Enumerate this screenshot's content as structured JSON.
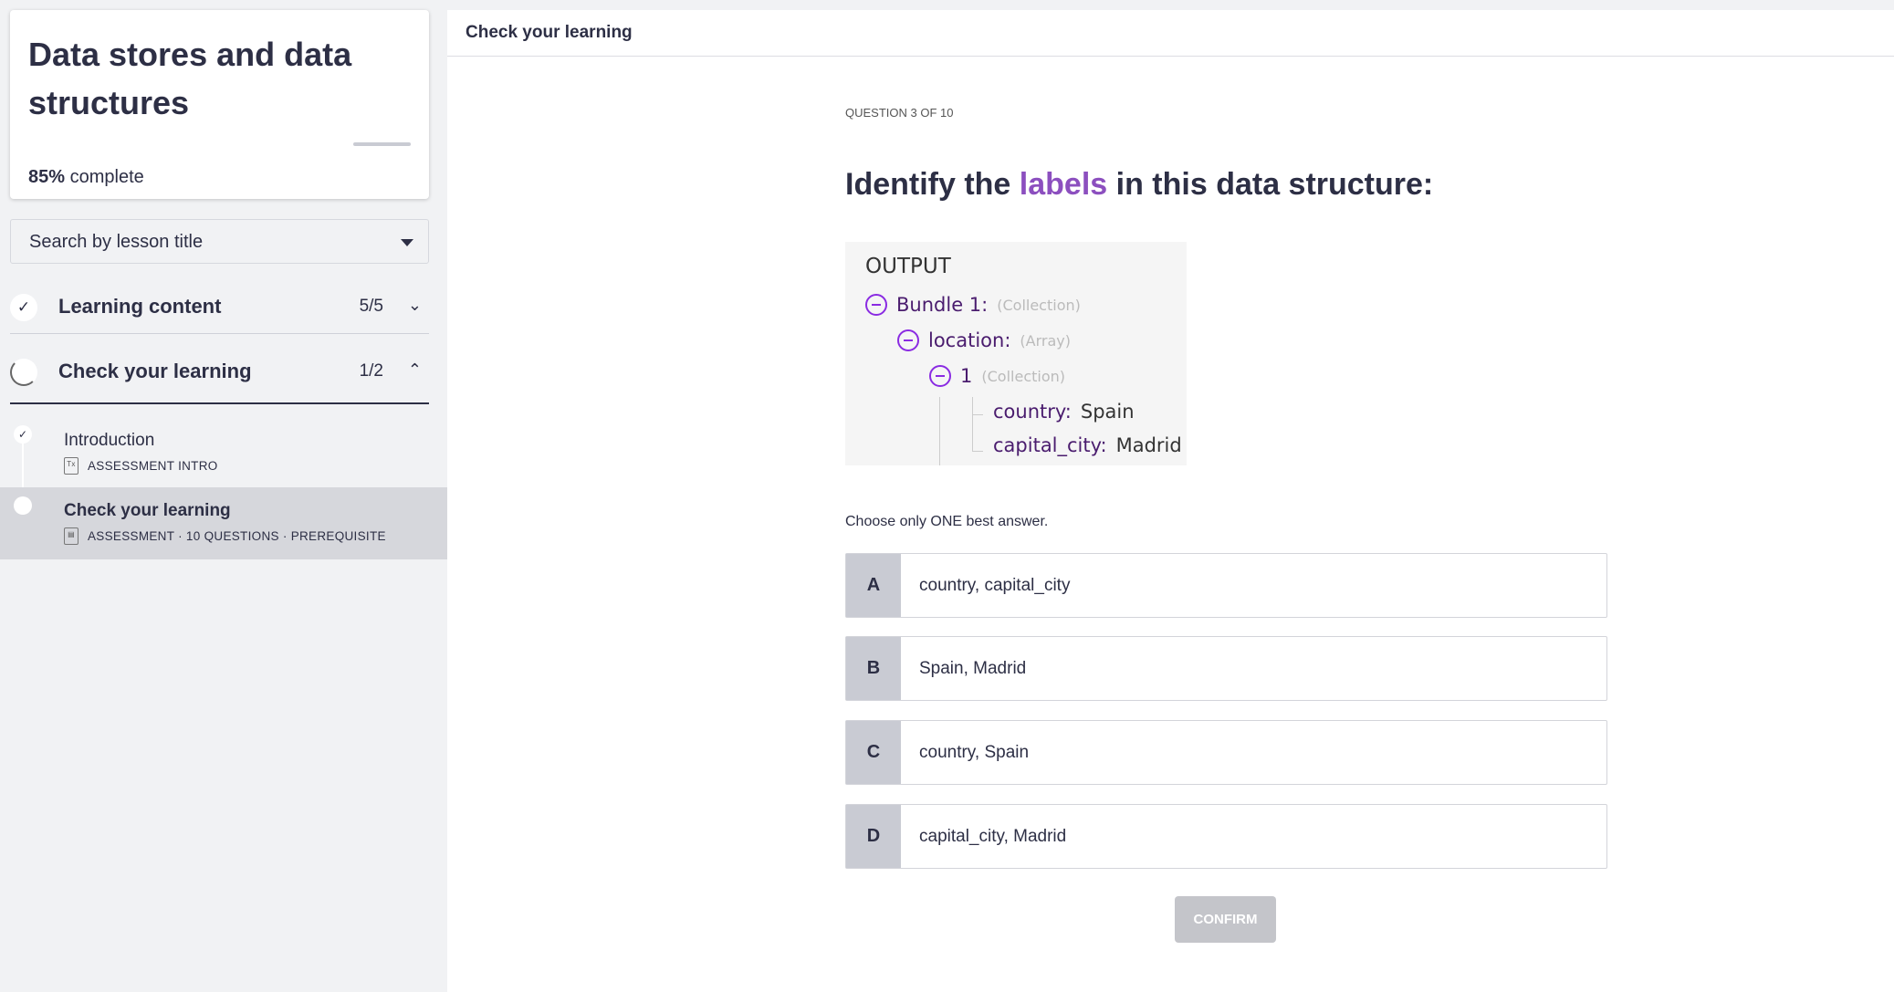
{
  "sidebar": {
    "course_title": "Data stores and data structures",
    "progress_percent": "85%",
    "progress_suffix": "complete",
    "progress_value": 85,
    "search_placeholder": "Search by lesson title",
    "sections": [
      {
        "title": "Learning content",
        "count": "5/5",
        "chevron": "⌄"
      },
      {
        "title": "Check your learning",
        "count": "1/2",
        "chevron": "⌃"
      }
    ],
    "lessons": [
      {
        "name": "Introduction",
        "meta": "ASSESSMENT INTRO"
      },
      {
        "name": "Check your learning",
        "meta": "ASSESSMENT · 10 QUESTIONS · PREREQUISITE"
      }
    ]
  },
  "main": {
    "header": "Check your learning",
    "question_number": "QUESTION 3 OF 10",
    "question_pre": "Identify the ",
    "question_highlight": "labels",
    "question_post": " in this data structure:",
    "output": {
      "label": "OUTPUT",
      "bundle": "Bundle 1:",
      "bundle_type": "(Collection)",
      "location": "location:",
      "location_type": "(Array)",
      "item": "1",
      "item_type": "(Collection)",
      "country_key": "country:",
      "country_val": "Spain",
      "capital_key": "capital_city:",
      "capital_val": "Madrid"
    },
    "instruction": "Choose only ONE best answer.",
    "options": [
      {
        "letter": "A",
        "text": "country, capital_city"
      },
      {
        "letter": "B",
        "text": "Spain, Madrid"
      },
      {
        "letter": "C",
        "text": "country, Spain"
      },
      {
        "letter": "D",
        "text": "capital_city, Madrid"
      }
    ],
    "confirm": "CONFIRM"
  }
}
